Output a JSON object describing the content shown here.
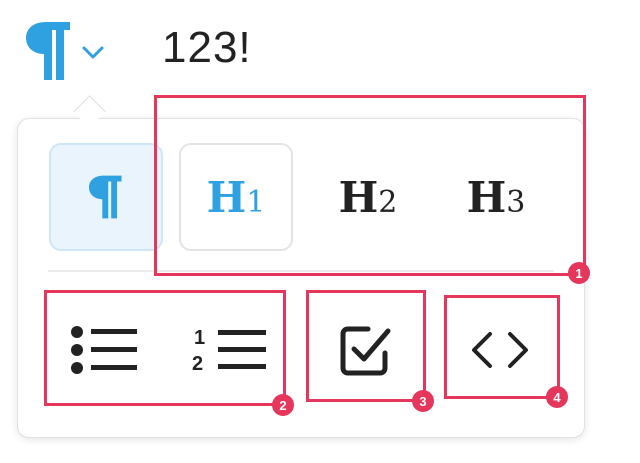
{
  "top": {
    "text": "123!",
    "trigger_icon": "pilcrow-icon",
    "dropdown_icon": "chevron-down-icon"
  },
  "popup": {
    "paragraph": {
      "icon": "pilcrow-icon",
      "state": "selected"
    },
    "headings": [
      {
        "letter": "H",
        "level": "1",
        "state": "hovered"
      },
      {
        "letter": "H",
        "level": "2"
      },
      {
        "letter": "H",
        "level": "3"
      }
    ],
    "lists": {
      "bullet": {
        "icon": "bulleted-list-icon"
      },
      "numbered": {
        "icon": "numbered-list-icon",
        "digits": [
          "1",
          "2"
        ]
      }
    },
    "checklist": {
      "icon": "checkbox-checked-icon"
    },
    "code": {
      "icon": "code-brackets-icon"
    }
  },
  "annotations": [
    "1",
    "2",
    "3",
    "4"
  ],
  "colors": {
    "accent": "#2fa0e0",
    "selected_bg": "#e9f4fc",
    "annotation": "#e5365b",
    "text": "#222222"
  }
}
